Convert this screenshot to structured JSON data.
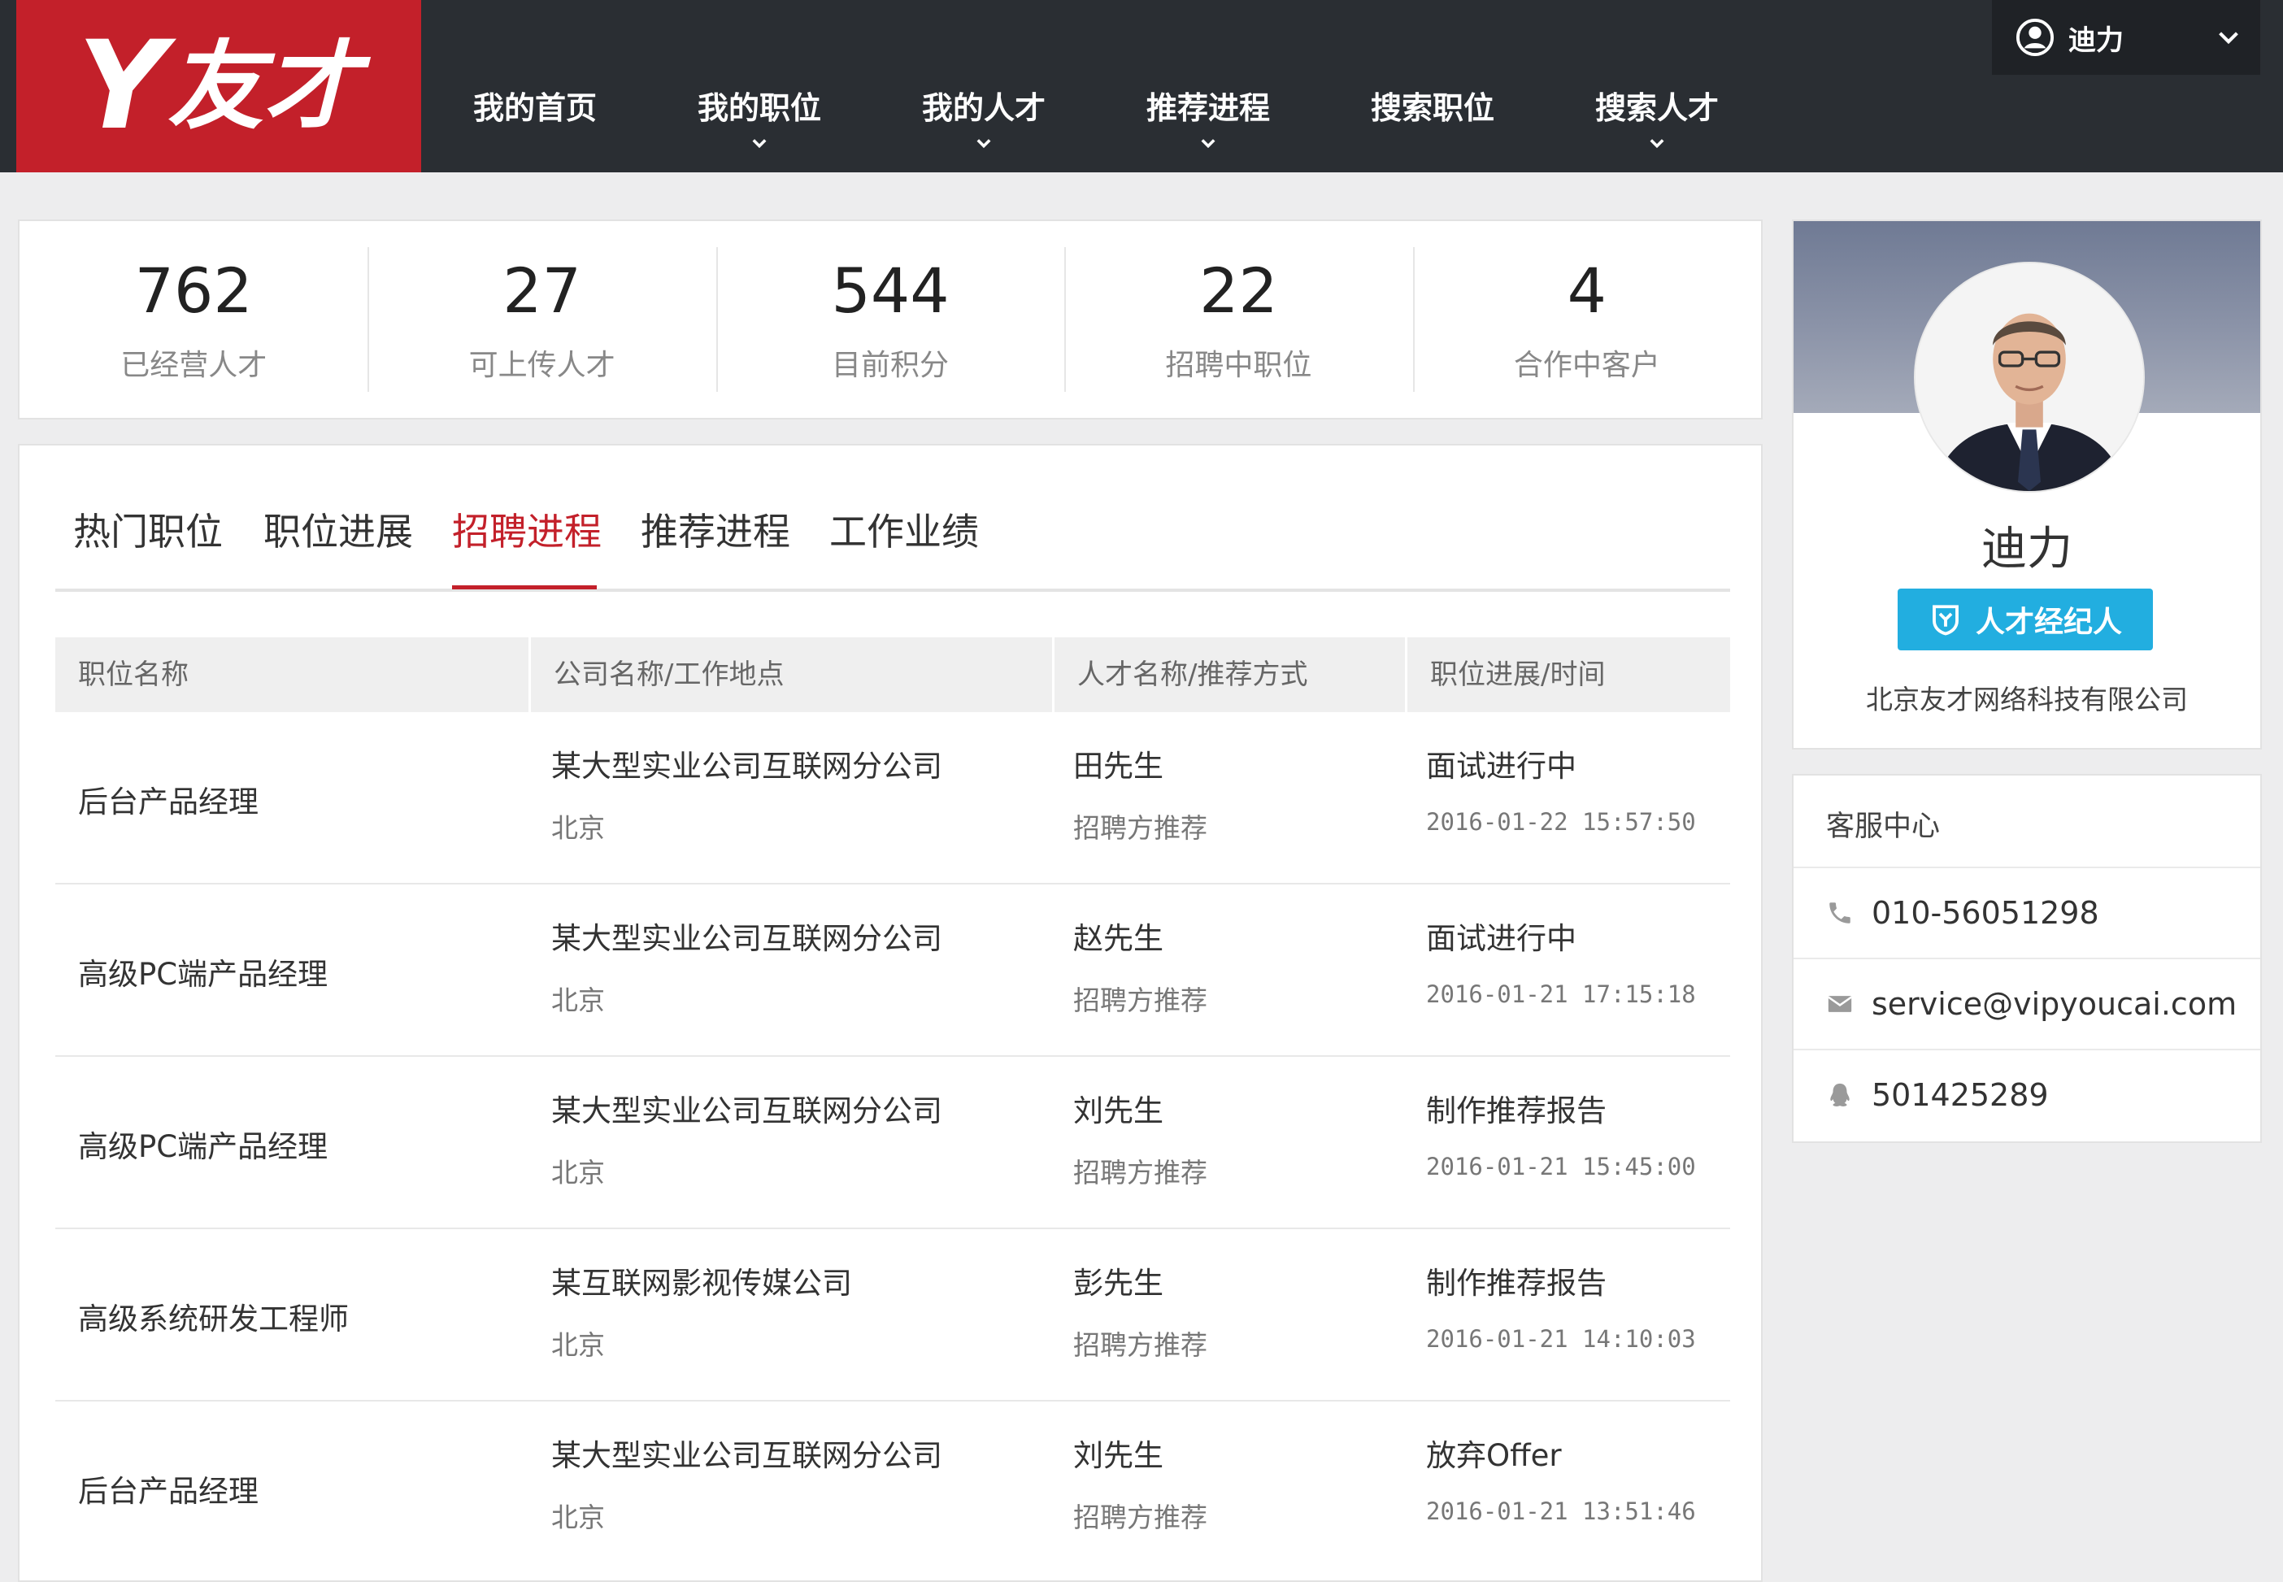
{
  "brand": {
    "logo_text": "友才",
    "logo_mark": "Y",
    "color": "#c3202a"
  },
  "nav": {
    "items": [
      {
        "label": "我的首页",
        "has_dropdown": false
      },
      {
        "label": "我的职位",
        "has_dropdown": true
      },
      {
        "label": "我的人才",
        "has_dropdown": true
      },
      {
        "label": "推荐进程",
        "has_dropdown": true
      },
      {
        "label": "搜索职位",
        "has_dropdown": false
      },
      {
        "label": "搜索人才",
        "has_dropdown": true
      }
    ],
    "user": {
      "name": "迪力",
      "icon": "user-circle-icon"
    }
  },
  "stats": [
    {
      "value": "762",
      "label": "已经营人才"
    },
    {
      "value": "27",
      "label": "可上传人才"
    },
    {
      "value": "544",
      "label": "目前积分"
    },
    {
      "value": "22",
      "label": "招聘中职位"
    },
    {
      "value": "4",
      "label": "合作中客户"
    }
  ],
  "tabs": {
    "items": [
      "热门职位",
      "职位进展",
      "招聘进程",
      "推荐进程",
      "工作业绩"
    ],
    "active_index": 2,
    "active_color": "#c3202a"
  },
  "table": {
    "headers": [
      "职位名称",
      "公司名称/工作地点",
      "人才名称/推荐方式",
      "职位进展/时间"
    ],
    "rows": [
      {
        "position": "后台产品经理",
        "company": "某大型实业公司互联网分公司",
        "location": "北京",
        "candidate": "田先生",
        "method": "招聘方推荐",
        "status": "面试进行中",
        "time": "2016-01-22 15:57:50"
      },
      {
        "position": "高级PC端产品经理",
        "company": "某大型实业公司互联网分公司",
        "location": "北京",
        "candidate": "赵先生",
        "method": "招聘方推荐",
        "status": "面试进行中",
        "time": "2016-01-21 17:15:18"
      },
      {
        "position": "高级PC端产品经理",
        "company": "某大型实业公司互联网分公司",
        "location": "北京",
        "candidate": "刘先生",
        "method": "招聘方推荐",
        "status": "制作推荐报告",
        "time": "2016-01-21 15:45:00"
      },
      {
        "position": "高级系统研发工程师",
        "company": "某互联网影视传媒公司",
        "location": "北京",
        "candidate": "彭先生",
        "method": "招聘方推荐",
        "status": "制作推荐报告",
        "time": "2016-01-21 14:10:03"
      },
      {
        "position": "后台产品经理",
        "company": "某大型实业公司互联网分公司",
        "location": "北京",
        "candidate": "刘先生",
        "method": "招聘方推荐",
        "status": "放弃Offer",
        "time": "2016-01-21 13:51:46"
      }
    ]
  },
  "profile": {
    "name": "迪力",
    "badge": "人才经纪人",
    "badge_color": "#22aee0",
    "company": "北京友才网络科技有限公司"
  },
  "service": {
    "title": "客服中心",
    "items": [
      {
        "icon": "phone-icon",
        "text": "010-56051298"
      },
      {
        "icon": "mail-icon",
        "text": "service@vipyoucai.com"
      },
      {
        "icon": "qq-icon",
        "text": "501425289"
      }
    ]
  }
}
